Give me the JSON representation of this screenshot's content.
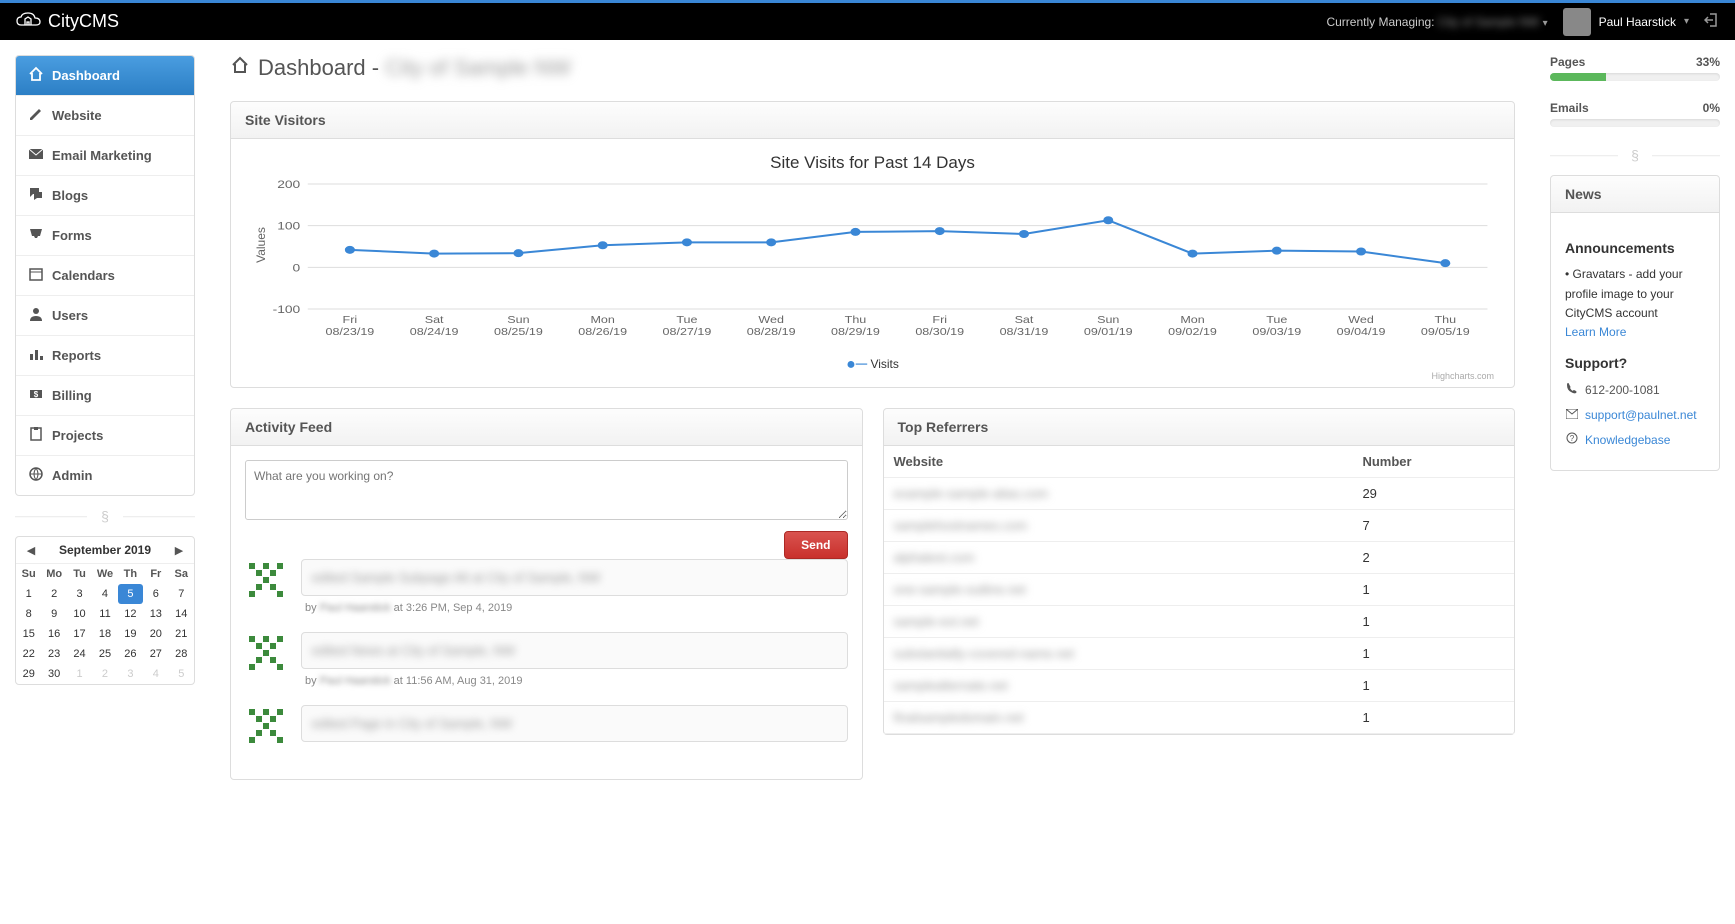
{
  "topbar": {
    "brand": "CityCMS",
    "currently_managing_label": "Currently Managing:",
    "currently_managing_value": "City of Sample NW",
    "user_name": "Paul Haarstick"
  },
  "sidebar": {
    "items": [
      {
        "label": "Dashboard",
        "icon": "home-icon",
        "active": true
      },
      {
        "label": "Website",
        "icon": "pencil-icon",
        "active": false
      },
      {
        "label": "Email Marketing",
        "icon": "envelope-icon",
        "active": false
      },
      {
        "label": "Blogs",
        "icon": "comments-icon",
        "active": false
      },
      {
        "label": "Forms",
        "icon": "inbox-icon",
        "active": false
      },
      {
        "label": "Calendars",
        "icon": "calendar-icon",
        "active": false
      },
      {
        "label": "Users",
        "icon": "user-icon",
        "active": false
      },
      {
        "label": "Reports",
        "icon": "barchart-icon",
        "active": false
      },
      {
        "label": "Billing",
        "icon": "dollar-icon",
        "active": false
      },
      {
        "label": "Projects",
        "icon": "clipboard-icon",
        "active": false
      },
      {
        "label": "Admin",
        "icon": "globe-icon",
        "active": false
      }
    ]
  },
  "calendar": {
    "title": "September 2019",
    "dow": [
      "Su",
      "Mo",
      "Tu",
      "We",
      "Th",
      "Fr",
      "Sa"
    ],
    "weeks": [
      [
        {
          "d": "1"
        },
        {
          "d": "2"
        },
        {
          "d": "3"
        },
        {
          "d": "4"
        },
        {
          "d": "5",
          "today": true
        },
        {
          "d": "6"
        },
        {
          "d": "7"
        }
      ],
      [
        {
          "d": "8"
        },
        {
          "d": "9"
        },
        {
          "d": "10"
        },
        {
          "d": "11"
        },
        {
          "d": "12"
        },
        {
          "d": "13"
        },
        {
          "d": "14"
        }
      ],
      [
        {
          "d": "15"
        },
        {
          "d": "16"
        },
        {
          "d": "17"
        },
        {
          "d": "18"
        },
        {
          "d": "19"
        },
        {
          "d": "20"
        },
        {
          "d": "21"
        }
      ],
      [
        {
          "d": "22"
        },
        {
          "d": "23"
        },
        {
          "d": "24"
        },
        {
          "d": "25"
        },
        {
          "d": "26"
        },
        {
          "d": "27"
        },
        {
          "d": "28"
        }
      ],
      [
        {
          "d": "29"
        },
        {
          "d": "30"
        },
        {
          "d": "1",
          "other": true
        },
        {
          "d": "2",
          "other": true
        },
        {
          "d": "3",
          "other": true
        },
        {
          "d": "4",
          "other": true
        },
        {
          "d": "5",
          "other": true
        }
      ]
    ]
  },
  "page_title_prefix": "Dashboard - ",
  "page_title_suffix": "City of Sample NW",
  "visitors_panel": {
    "heading": "Site Visitors"
  },
  "chart_data": {
    "type": "line",
    "title": "Site Visits for Past 14 Days",
    "ylabel": "Values",
    "ylim": [
      -100,
      200
    ],
    "yticks": [
      -100,
      0,
      100,
      200
    ],
    "categories": [
      [
        "Fri",
        "08/23/19"
      ],
      [
        "Sat",
        "08/24/19"
      ],
      [
        "Sun",
        "08/25/19"
      ],
      [
        "Mon",
        "08/26/19"
      ],
      [
        "Tue",
        "08/27/19"
      ],
      [
        "Wed",
        "08/28/19"
      ],
      [
        "Thu",
        "08/29/19"
      ],
      [
        "Fri",
        "08/30/19"
      ],
      [
        "Sat",
        "08/31/19"
      ],
      [
        "Sun",
        "09/01/19"
      ],
      [
        "Mon",
        "09/02/19"
      ],
      [
        "Tue",
        "09/03/19"
      ],
      [
        "Wed",
        "09/04/19"
      ],
      [
        "Thu",
        "09/05/19"
      ]
    ],
    "series": [
      {
        "name": "Visits",
        "values": [
          42,
          33,
          34,
          53,
          60,
          60,
          85,
          87,
          80,
          113,
          33,
          40,
          38,
          10
        ]
      }
    ],
    "credit": "Highcharts.com"
  },
  "activity": {
    "heading": "Activity Feed",
    "placeholder": "What are you working on?",
    "send_label": "Send",
    "items": [
      {
        "text": "edited Sample Subpage Alt at City of Sample, NW",
        "by_prefix": "by ",
        "by_name": "Paul Haarstick",
        "by_suffix": " at 3:26 PM, Sep 4, 2019"
      },
      {
        "text": "edited News at City of Sample, NW",
        "by_prefix": "by ",
        "by_name": "Paul Haarstick",
        "by_suffix": " at 11:56 AM, Aug 31, 2019"
      },
      {
        "text": "edited Page in City of Sample, NW"
      }
    ]
  },
  "referrers": {
    "heading": "Top Referrers",
    "col_website": "Website",
    "col_number": "Number",
    "rows": [
      {
        "site": "example-sample-alias.com",
        "num": "29"
      },
      {
        "site": "samplehostnames.com",
        "num": "7"
      },
      {
        "site": "alphatest.com",
        "num": "2"
      },
      {
        "site": "one-sample-outline.net",
        "num": "1"
      },
      {
        "site": "sample-ext.net",
        "num": "1"
      },
      {
        "site": "substantially-covered-name.net",
        "num": "1"
      },
      {
        "site": "samplealternate.net",
        "num": "1"
      },
      {
        "site": "finalsampledomain.net",
        "num": "1"
      }
    ]
  },
  "progress": {
    "pages_label": "Pages",
    "pages_pct": "33%",
    "pages_fill": 33,
    "emails_label": "Emails",
    "emails_pct": "0%",
    "emails_fill": 0
  },
  "news": {
    "heading": "News",
    "announce_title": "Announcements",
    "gravatar_bullet": "• Gravatars - add your profile image to your CityCMS account",
    "learn_more": "Learn More",
    "support_title": "Support?",
    "phone": "612-200-1081",
    "email": "support@paulnet.net",
    "kb": "Knowledgebase"
  }
}
